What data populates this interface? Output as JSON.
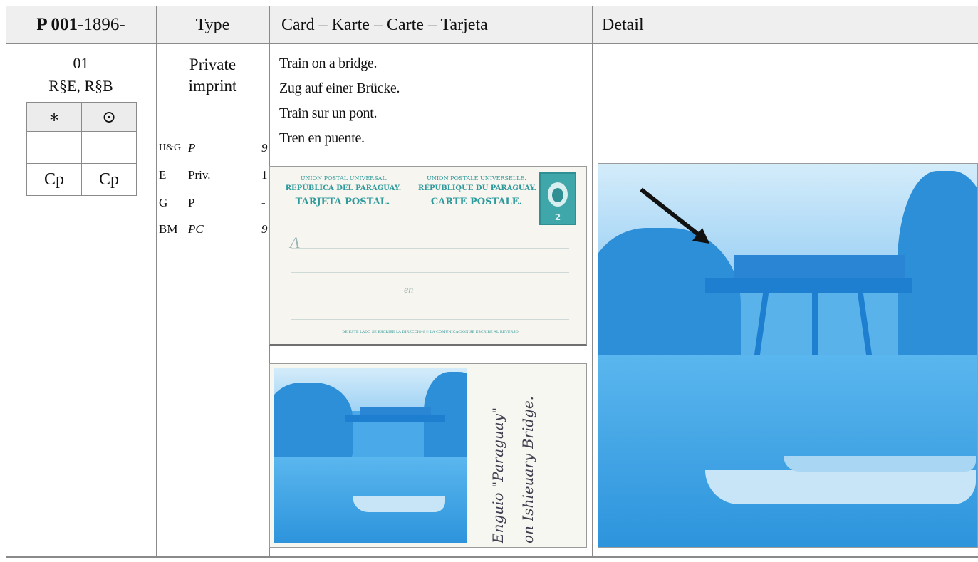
{
  "header": {
    "ref_bold": "P 001",
    "ref_rest": "-1896-",
    "type": "Type",
    "card": "Card – Karte – Carte – Tarjeta",
    "detail": "Detail"
  },
  "entry": {
    "number": "01",
    "reverse": "R§E, R§B",
    "condition": {
      "mint_symbol": "∗",
      "used_symbol": "⊙",
      "mint_value": "",
      "used_value": "",
      "mint_code": "Cp",
      "used_code": "Cp"
    },
    "type_line1": "Private",
    "type_line2": "imprint",
    "catalogues": [
      {
        "key": "H&G",
        "value": "P",
        "num": "9"
      },
      {
        "key": "E",
        "value": "Priv.",
        "num": "1"
      },
      {
        "key": "G",
        "value": "P",
        "num": "-"
      },
      {
        "key": "BM",
        "value": "PC",
        "num": "9"
      }
    ],
    "description": [
      "Train on a bridge.",
      "Zug auf einer Brücke.",
      "Train sur un pont.",
      "Tren en puente."
    ]
  },
  "card_front": {
    "left_line1": "UNION POSTAL UNIVERSAL.",
    "left_line2": "REPÚBLICA DEL PARAGUAY.",
    "left_line3": "TARJETA POSTAL.",
    "right_line1": "UNION POSTALE UNIVERSELLE.",
    "right_line2": "RÉPUBLIQUE DU PARAGUAY.",
    "right_line3": "CARTE POSTALE.",
    "salutation": "A",
    "en": "en",
    "footer": "DE ESTE LADO SE ESCRIBE LA DIRECCION  ☉  LA COMUNICACION SE ESCRIBE AL REVERSO",
    "stamp_value": "2"
  },
  "card_back": {
    "script_line1": "Enguio \"Paraguay\"",
    "script_line2": "on Ishieuary Bridge."
  },
  "colors": {
    "header_bg": "#efefef",
    "rule": "#8a8a8a",
    "cyanotype": "#4aa9e8",
    "stamp": "#3fa6a9"
  }
}
